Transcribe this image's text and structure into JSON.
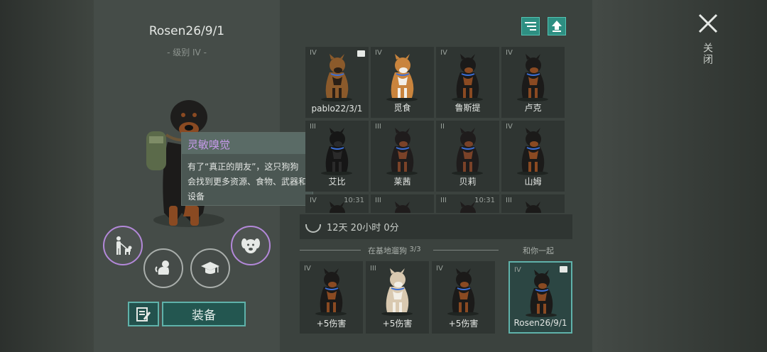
{
  "dog": {
    "name": "Rosen26/9/1",
    "level": "- 级别 IV -"
  },
  "tooltip": {
    "title": "灵敏嗅觉",
    "body": "有了“真正的朋友”，这只狗狗会找到更多资源、食物、武器和设备"
  },
  "actions": {
    "equip_label": "装备",
    "icons": [
      "walk-with-dog-icon",
      "puppy-icon",
      "graduation-cap-icon",
      "dog-face-icon",
      "notes-icon"
    ]
  },
  "toolbar": {
    "icons": [
      "sort-icon",
      "upload-icon"
    ]
  },
  "dogs": [
    {
      "level": "IV",
      "name": "pablo22/3/1",
      "breed": "shepherd",
      "boxed": true
    },
    {
      "level": "IV",
      "name": "觅食",
      "breed": "corgi"
    },
    {
      "level": "IV",
      "name": "鲁斯提",
      "breed": "rottweiler"
    },
    {
      "level": "IV",
      "name": "卢克",
      "breed": "rottweiler"
    },
    {
      "level": "III",
      "name": "艾比",
      "breed": "doberman-black"
    },
    {
      "level": "III",
      "name": "莱茜",
      "breed": "doberman"
    },
    {
      "level": "II",
      "name": "贝莉",
      "breed": "doberman"
    },
    {
      "level": "IV",
      "name": "山姆",
      "breed": "rottweiler"
    },
    {
      "level": "IV",
      "name": "",
      "breed": "rottweiler",
      "time": "10:31"
    },
    {
      "level": "III",
      "name": "",
      "breed": "doberman"
    },
    {
      "level": "III",
      "name": "",
      "breed": "doberman",
      "time": "10:31"
    },
    {
      "level": "III",
      "name": "",
      "breed": "rottweiler"
    }
  ],
  "timer": "12天 20小时 0分",
  "walking": {
    "label": "在基地遛狗",
    "count": "3/3",
    "dogs": [
      {
        "level": "IV",
        "name": "+5伤害",
        "breed": "rottweiler"
      },
      {
        "level": "III",
        "name": "+5伤害",
        "breed": "husky"
      },
      {
        "level": "IV",
        "name": "+5伤害",
        "breed": "rottweiler"
      }
    ]
  },
  "with_you": {
    "label": "和你一起",
    "dog": {
      "level": "IV",
      "name": "Rosen26/9/1",
      "breed": "rottweiler",
      "boxed": true
    }
  },
  "close_label": "关闭",
  "colors": {
    "accent": "#5fb2aa",
    "purple": "#b388d9",
    "tooltip_title": "#c69ae9"
  }
}
